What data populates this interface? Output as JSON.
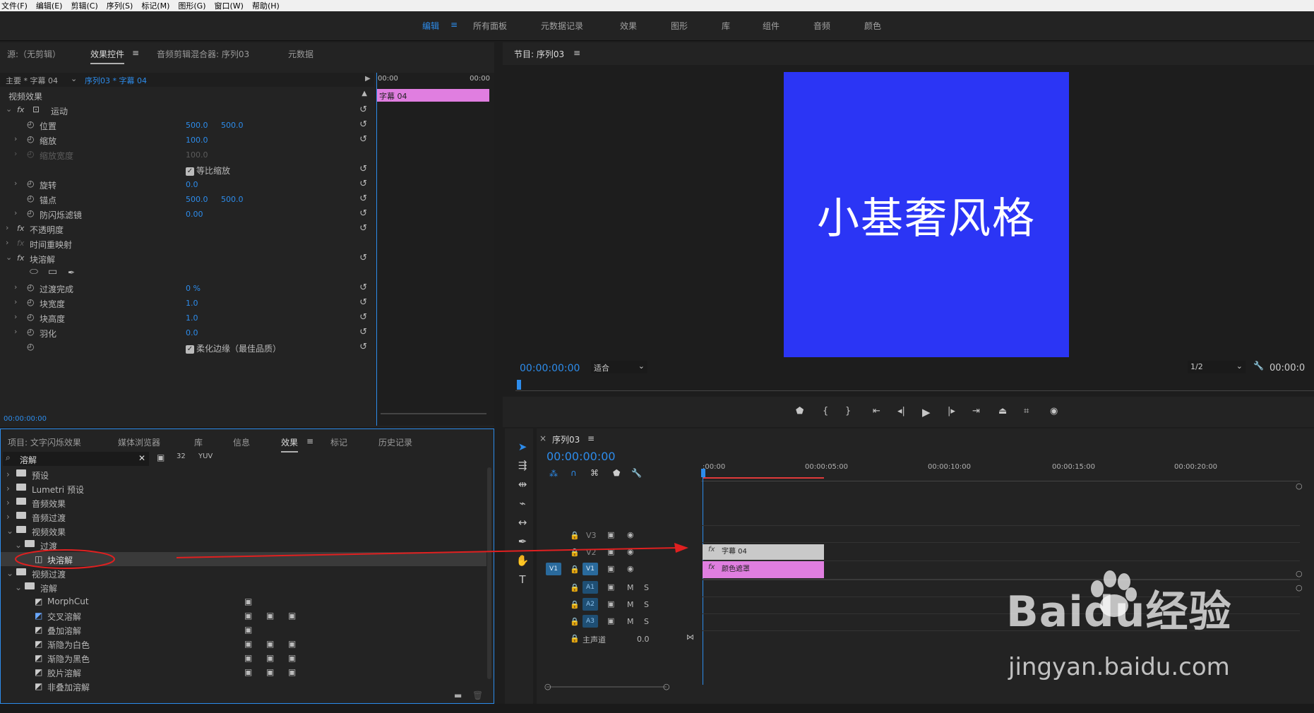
{
  "menu": [
    "文件(F)",
    "编辑(E)",
    "剪辑(C)",
    "序列(S)",
    "标记(M)",
    "图形(G)",
    "窗口(W)",
    "帮助(H)"
  ],
  "workspaces": [
    "编辑",
    "所有面板",
    "元数据记录",
    "效果",
    "图形",
    "库",
    "组件",
    "音频",
    "颜色"
  ],
  "effect_controls": {
    "tabs": [
      "源:（无剪辑）",
      "效果控件",
      "音频剪辑混合器: 序列03",
      "元数据"
    ],
    "clip_selector_master": "主要 * 字幕 04",
    "clip_selector_seq": "序列03 * 字幕 04",
    "mini_timeline_start": "00:00",
    "mini_timeline_end": "00:00",
    "clip_label": "字幕 04",
    "section_video": "视频效果",
    "rows": [
      {
        "label": "运动",
        "v1": "",
        "v2": ""
      },
      {
        "label": "位置",
        "v1": "500.0",
        "v2": "500.0"
      },
      {
        "label": "缩放",
        "v1": "100.0",
        "v2": ""
      },
      {
        "label": "缩放宽度",
        "v1": "100.0",
        "v2": ""
      },
      {
        "label": "等比缩放",
        "v1": "",
        "v2": ""
      },
      {
        "label": "旋转",
        "v1": "0.0",
        "v2": ""
      },
      {
        "label": "锚点",
        "v1": "500.0",
        "v2": "500.0"
      },
      {
        "label": "防闪烁滤镜",
        "v1": "0.00",
        "v2": ""
      },
      {
        "label": "不透明度",
        "v1": "",
        "v2": ""
      },
      {
        "label": "时间重映射",
        "v1": "",
        "v2": ""
      },
      {
        "label": "块溶解",
        "v1": "",
        "v2": ""
      },
      {
        "label": "过渡完成",
        "v1": "0 %",
        "v2": ""
      },
      {
        "label": "块宽度",
        "v1": "1.0",
        "v2": ""
      },
      {
        "label": "块高度",
        "v1": "1.0",
        "v2": ""
      },
      {
        "label": "羽化",
        "v1": "0.0",
        "v2": ""
      },
      {
        "label": "柔化边缘（最佳品质）",
        "v1": "",
        "v2": ""
      }
    ],
    "timecode": "00:00:00:00"
  },
  "program_monitor": {
    "title": "节目: 序列03",
    "preview_text": "小基奢风格",
    "preview_bg": "#2b35f5",
    "timecode": "00:00:00:00",
    "fit": "适合",
    "resolution": "1/2",
    "right_timecode": "00:00:0"
  },
  "project_panel": {
    "tabs": [
      "项目: 文字闪烁效果",
      "媒体浏览器",
      "库",
      "信息",
      "效果",
      "标记",
      "历史记录"
    ],
    "search_value": "溶解",
    "tree": [
      {
        "label": "预设",
        "indent": 0,
        "type": "folder"
      },
      {
        "label": "Lumetri 预设",
        "indent": 0,
        "type": "folder"
      },
      {
        "label": "音频效果",
        "indent": 0,
        "type": "folder"
      },
      {
        "label": "音频过渡",
        "indent": 0,
        "type": "folder"
      },
      {
        "label": "视频效果",
        "indent": 0,
        "type": "folder"
      },
      {
        "label": "过渡",
        "indent": 1,
        "type": "folder"
      },
      {
        "label": "块溶解",
        "indent": 2,
        "type": "effect"
      },
      {
        "label": "视频过渡",
        "indent": 0,
        "type": "folder"
      },
      {
        "label": "溶解",
        "indent": 1,
        "type": "folder"
      },
      {
        "label": "MorphCut",
        "indent": 2,
        "type": "effect"
      },
      {
        "label": "交叉溶解",
        "indent": 2,
        "type": "effect"
      },
      {
        "label": "叠加溶解",
        "indent": 2,
        "type": "effect"
      },
      {
        "label": "渐隐为白色",
        "indent": 2,
        "type": "effect"
      },
      {
        "label": "渐隐为黑色",
        "indent": 2,
        "type": "effect"
      },
      {
        "label": "胶片溶解",
        "indent": 2,
        "type": "effect"
      },
      {
        "label": "非叠加溶解",
        "indent": 2,
        "type": "effect"
      }
    ]
  },
  "timeline": {
    "tab": "序列03",
    "timecode": "00:00:00:00",
    "ruler": [
      ":00:00",
      "00:00:05:00",
      "00:00:10:00",
      "00:00:15:00",
      "00:00:20:00"
    ],
    "video_tracks": [
      "V3",
      "V2",
      "V1"
    ],
    "audio_tracks": [
      "A1",
      "A2",
      "A3"
    ],
    "v1_source": "V1",
    "master_label": "主声道",
    "master_value": "0.0",
    "clip_top": "字幕 04",
    "clip_bottom": "颜色遮罩",
    "clip_top_color": "#c9c9c9",
    "clip_bottom_color": "#e07ee0",
    "mute": "M",
    "solo": "S"
  },
  "watermark": {
    "brand": "Baidu经验",
    "url": "jingyan.baidu.com"
  }
}
